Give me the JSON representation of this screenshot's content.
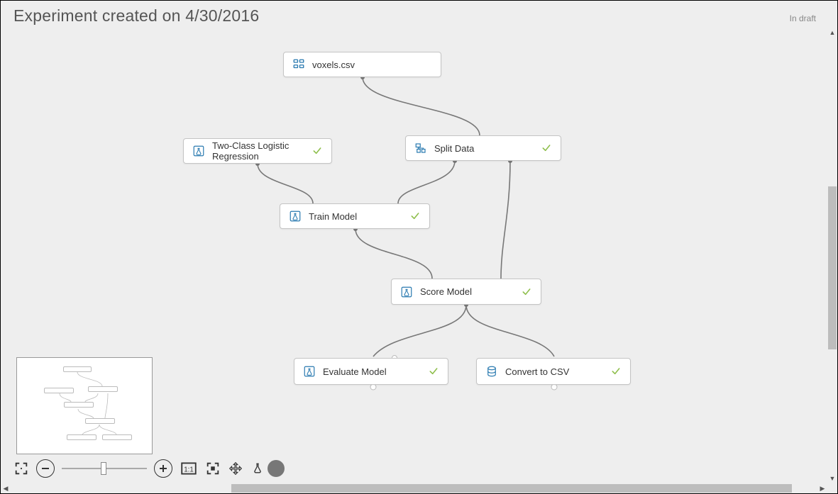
{
  "header": {
    "title": "Experiment created on 4/30/2016",
    "status": "In draft"
  },
  "nodes": {
    "voxels": {
      "label": "voxels.csv",
      "status": ""
    },
    "logreg": {
      "label": "Two-Class Logistic Regression",
      "status": "✓"
    },
    "split": {
      "label": "Split Data",
      "status": "✓"
    },
    "train": {
      "label": "Train Model",
      "status": "✓"
    },
    "score": {
      "label": "Score Model",
      "status": "✓"
    },
    "evaluate": {
      "label": "Evaluate Model",
      "status": "✓"
    },
    "csv": {
      "label": "Convert to CSV",
      "status": "✓"
    }
  },
  "toolbar": {
    "fullscreen": "fullscreen",
    "zoom_out": "−",
    "zoom_in": "+",
    "actual_size": "1:1",
    "fit": "fit",
    "pan": "pan",
    "flask": "flask"
  }
}
